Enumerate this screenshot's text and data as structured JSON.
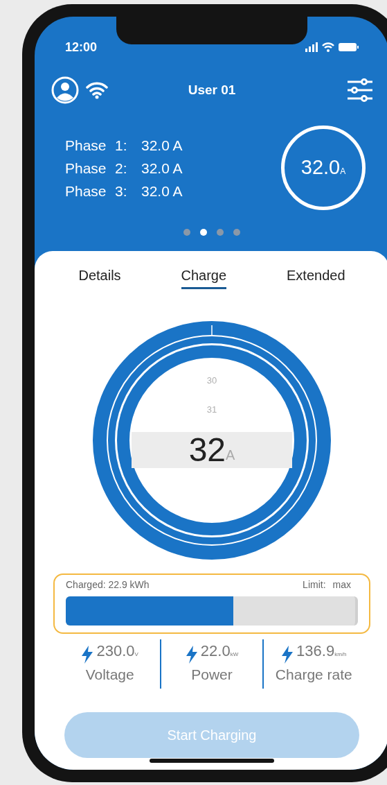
{
  "status_bar": {
    "time": "12:00"
  },
  "header": {
    "title": "User 01"
  },
  "phases": [
    {
      "label": "Phase",
      "index": "1:",
      "value": "32.0 A"
    },
    {
      "label": "Phase",
      "index": "2:",
      "value": "32.0 A"
    },
    {
      "label": "Phase",
      "index": "3:",
      "value": "32.0 A"
    }
  ],
  "total": {
    "value": "32.0",
    "unit": "A"
  },
  "pager": [
    {
      "selected": false
    },
    {
      "selected": true
    },
    {
      "selected": false
    },
    {
      "selected": false
    }
  ],
  "tabs": [
    {
      "label": "Details",
      "selected": false
    },
    {
      "label": "Charge",
      "selected": true
    },
    {
      "label": "Extended",
      "selected": false
    }
  ],
  "picker": {
    "options": [
      "30",
      "31"
    ],
    "value": "32",
    "unit": "A"
  },
  "charge_bar": {
    "charged": "Charged: 22.9 kWh",
    "limit_label": "Limit:",
    "limit_value": "max",
    "level": 0.58
  },
  "stats": [
    {
      "value": "230.0",
      "unit": "V",
      "label": "Voltage"
    },
    {
      "value": "22.0",
      "unit": "kW",
      "label": "Power"
    },
    {
      "value": "136.9",
      "unit": "km/h",
      "label": "Charge rate"
    }
  ],
  "button": {
    "label": "Start Charging",
    "disabled": true
  }
}
